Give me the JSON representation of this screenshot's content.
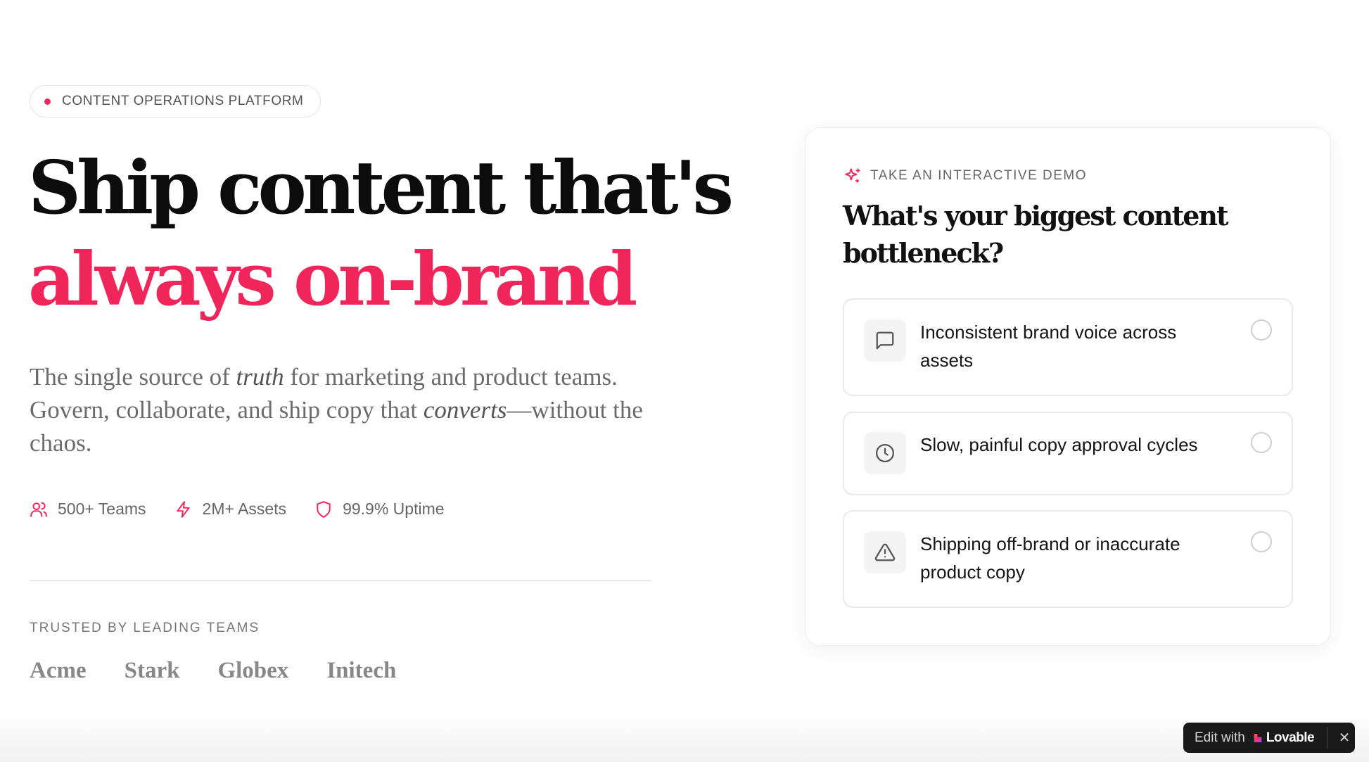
{
  "hero": {
    "badge": "CONTENT OPERATIONS PLATFORM",
    "headline_line1": "Ship content that's",
    "headline_line2": "always on-brand",
    "subtitle_part1": "The single source of ",
    "subtitle_em1": "truth",
    "subtitle_part2": " for marketing and product teams. Govern, collaborate, and ship copy that ",
    "subtitle_em2": "converts",
    "subtitle_part3": "—without the chaos.",
    "stats": [
      {
        "icon": "users-icon",
        "label": "500+ Teams"
      },
      {
        "icon": "lightning-icon",
        "label": "2M+ Assets"
      },
      {
        "icon": "shield-icon",
        "label": "99.9% Uptime"
      }
    ],
    "trusted_label": "TRUSTED BY LEADING TEAMS",
    "logos": [
      "Acme",
      "Stark",
      "Globex",
      "Initech"
    ]
  },
  "demo": {
    "kicker": "TAKE AN INTERACTIVE DEMO",
    "question": "What's your biggest content bottleneck?",
    "options": [
      {
        "icon": "message-square-icon",
        "label": "Inconsistent brand voice across assets"
      },
      {
        "icon": "clock-icon",
        "label": "Slow, painful copy approval cycles"
      },
      {
        "icon": "alert-triangle-icon",
        "label": "Shipping off-brand or inaccurate product copy"
      }
    ]
  },
  "lovable_badge": {
    "edit_label": "Edit with",
    "brand": "Lovable"
  },
  "colors": {
    "accent": "#f0265b",
    "text": "#0c0c0c",
    "muted": "#6b6b6b"
  }
}
